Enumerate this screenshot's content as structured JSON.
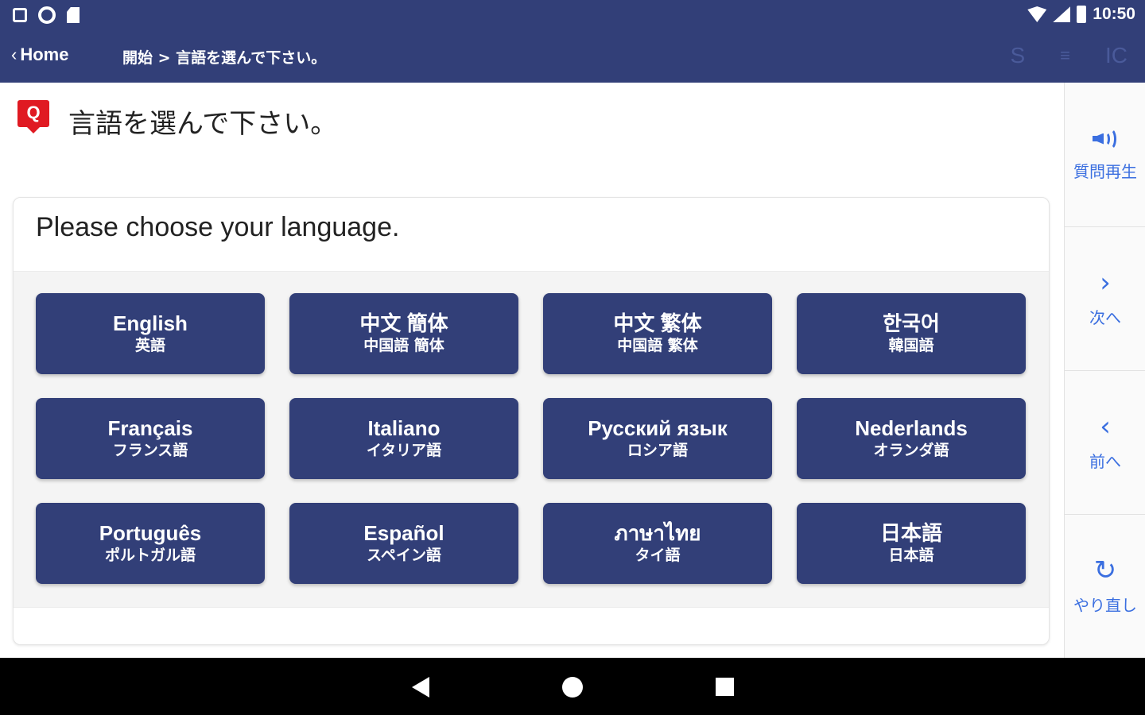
{
  "status_bar": {
    "time": "10:50"
  },
  "nav": {
    "home_label": "Home",
    "home_chevron": "‹",
    "breadcrumb": "開始 > 言語を選んで下さい。",
    "right_items": [
      "S",
      "≡",
      "IC"
    ]
  },
  "question": {
    "badge": "Q",
    "title": "言語を選んで下さい。"
  },
  "card": {
    "prompt": "Please choose your language.",
    "languages": [
      {
        "name": "English",
        "sub": "英語"
      },
      {
        "name": "中文 簡体",
        "sub": "中国語 簡体"
      },
      {
        "name": "中文 繁体",
        "sub": "中国語 繁体"
      },
      {
        "name": "한국어",
        "sub": "韓国語"
      },
      {
        "name": "Français",
        "sub": "フランス語"
      },
      {
        "name": "Italiano",
        "sub": "イタリア語"
      },
      {
        "name": "Русский язык",
        "sub": "ロシア語"
      },
      {
        "name": "Nederlands",
        "sub": "オランダ語"
      },
      {
        "name": "Português",
        "sub": "ポルトガル語"
      },
      {
        "name": "Español",
        "sub": "スペイン語"
      },
      {
        "name": "ภาษาไทย",
        "sub": "タイ語"
      },
      {
        "name": "日本語",
        "sub": "日本語"
      }
    ]
  },
  "sidebar": {
    "replay": {
      "label": "質問再生",
      "icon": "speaker-icon"
    },
    "next": {
      "label": "次へ",
      "icon": "›"
    },
    "prev": {
      "label": "前へ",
      "icon": "‹"
    },
    "redo": {
      "label": "やり直し",
      "icon": "↻"
    }
  },
  "colors": {
    "primary": "#323f78",
    "accent": "#3b6fe0",
    "badge_red": "#e01a22"
  }
}
